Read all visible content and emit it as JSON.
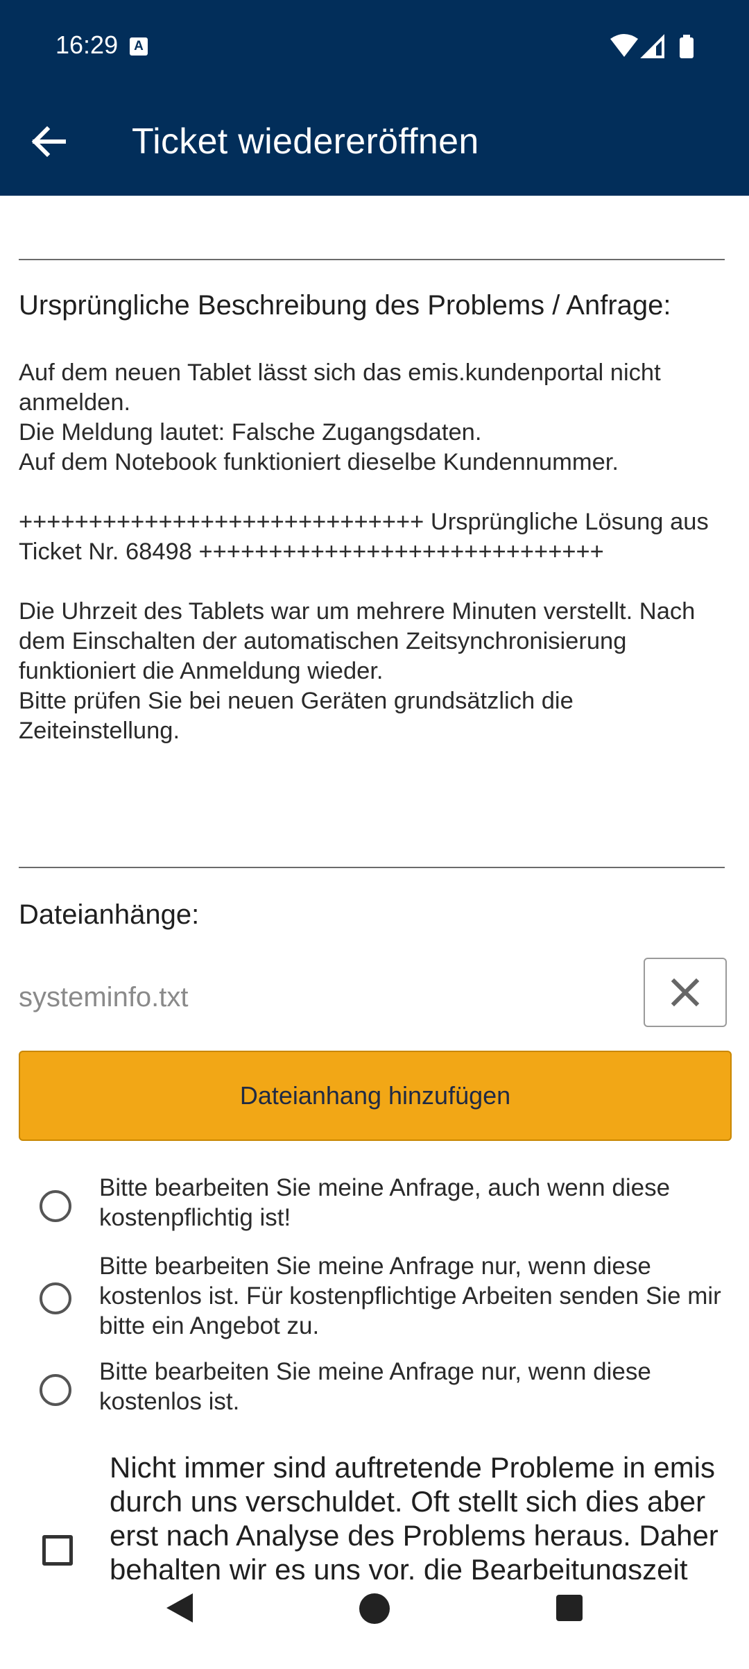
{
  "status_bar": {
    "time": "16:29",
    "icons": [
      "a-notification-icon",
      "wifi-icon",
      "signal-icon",
      "battery-icon"
    ]
  },
  "app_bar": {
    "title": "Ticket wiedereröffnen",
    "back_icon": "arrow-left-icon"
  },
  "description": {
    "heading": "Ursprüngliche Beschreibung des Problems / Anfrage:",
    "text": "Auf dem neuen Tablet lässt sich das emis.kundenportal nicht anmelden.\nDie Meldung lautet: Falsche Zugangsdaten.\nAuf dem Notebook funktioniert dieselbe Kundennummer.\n\n+++++++++++++++++++++++++++++ Ursprüngliche Lösung aus Ticket Nr. 68498 +++++++++++++++++++++++++++++\n\nDie Uhrzeit des Tablets war um mehrere Minuten verstellt. Nach dem Einschalten der automatischen Zeitsynchronisierung funktioniert die Anmeldung wieder.\nBitte prüfen Sie bei neuen Geräten grundsätzlich die Zeiteinstellung."
  },
  "attachments": {
    "heading": "Dateianhänge:",
    "file_name": "systeminfo.txt",
    "add_button_label": "Dateianhang hinzufügen"
  },
  "billing_options": [
    {
      "label": "Bitte bearbeiten Sie meine Anfrage, auch wenn diese kostenpflichtig ist!",
      "selected": false
    },
    {
      "label": "Bitte bearbeiten Sie meine Anfrage nur, wenn diese kostenlos ist. Für kostenpflichtige Arbeiten senden Sie mir bitte ein Angebot zu.",
      "selected": false
    },
    {
      "label": "Bitte bearbeiten Sie meine Anfrage nur, wenn diese kostenlos ist.",
      "selected": false
    }
  ],
  "consent": {
    "label": "Nicht immer sind auftretende Probleme in emis durch uns verschuldet. Oft stellt sich dies aber erst nach Analyse des Problems heraus. Daher behalten wir es uns vor, die Bearbeitungszeit",
    "checked": false
  },
  "colors": {
    "header_bg": "#022e5a",
    "accent_button": "#f2a716"
  }
}
